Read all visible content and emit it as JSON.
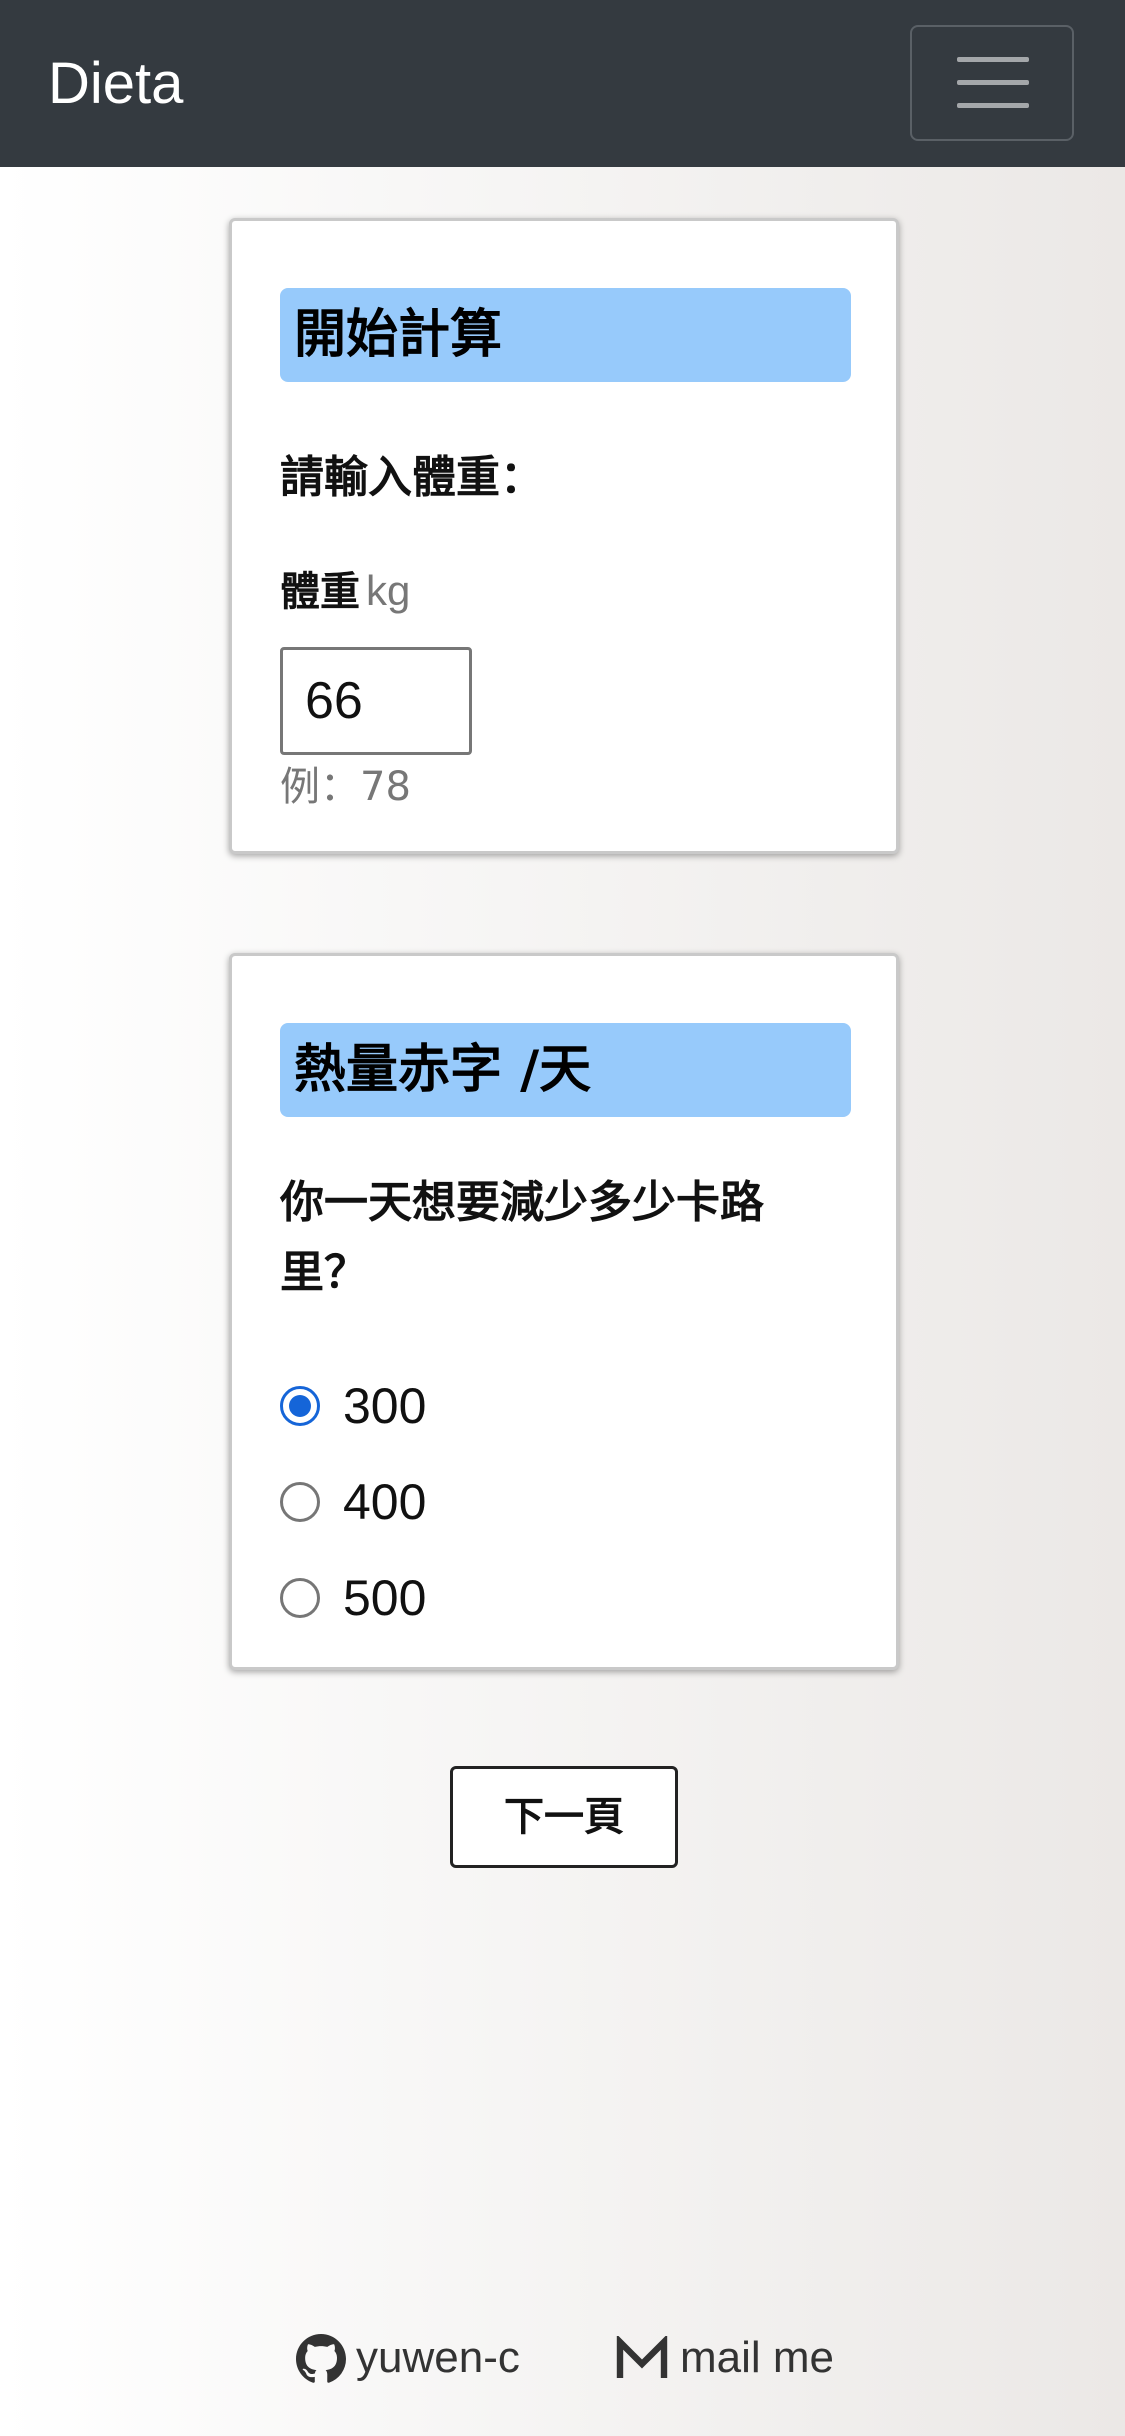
{
  "navbar": {
    "brand": "Dieta",
    "menu_icon": "hamburger-menu-icon"
  },
  "weight_card": {
    "title": "開始計算",
    "prompt": "請輸入體重：",
    "field_label": "體重",
    "unit": "kg",
    "value": "66",
    "hint": "例：78"
  },
  "deficit_card": {
    "title": "熱量赤字 /天",
    "prompt": "你一天想要減少多少卡路里？",
    "options": [
      {
        "label": "300",
        "selected": true
      },
      {
        "label": "400",
        "selected": false
      },
      {
        "label": "500",
        "selected": false
      }
    ]
  },
  "next_button": {
    "label": "下一頁"
  },
  "footer": {
    "github": {
      "label": "yuwen-c",
      "icon": "github-icon"
    },
    "mail": {
      "label": "mail me",
      "icon": "mail-icon"
    }
  },
  "colors": {
    "navbar_bg": "#343a40",
    "title_highlight": "#97cafb",
    "radio_accent": "#1565d8"
  }
}
